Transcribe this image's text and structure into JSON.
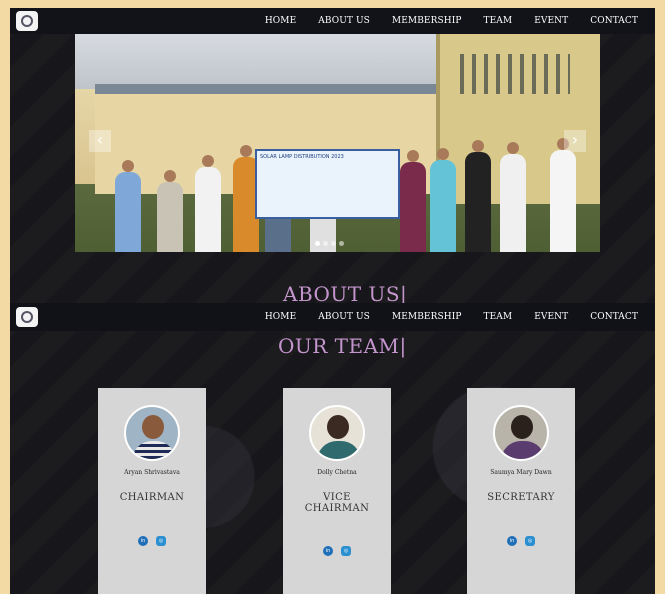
{
  "nav": {
    "items": [
      "HOME",
      "ABOUT US",
      "MEMBERSHIP",
      "TEAM",
      "EVENT",
      "CONTACT"
    ]
  },
  "hero": {
    "banner_text": "SOLAR LAMP DISTRIBUTION 2023",
    "prev_label": "‹",
    "next_label": "›"
  },
  "sections": {
    "about_title": "ABOUT US|",
    "team_title": "OUR TEAM|"
  },
  "team": [
    {
      "name": "Aryan Shrivastava",
      "role": "CHAIRMAN"
    },
    {
      "name": "Dolly Chetna",
      "role": "VICE CHAIRMAN"
    },
    {
      "name": "Saumya Mary Dawn",
      "role": "SECRETARY"
    }
  ],
  "colors": {
    "accent": "#c495cc",
    "social_blue": "#1f6fb8",
    "card_bg": "#d6d6d6",
    "outer_bg": "#f3d9a4"
  },
  "icons": {
    "linkedin": "linkedin-icon",
    "instagram": "instagram-icon"
  }
}
